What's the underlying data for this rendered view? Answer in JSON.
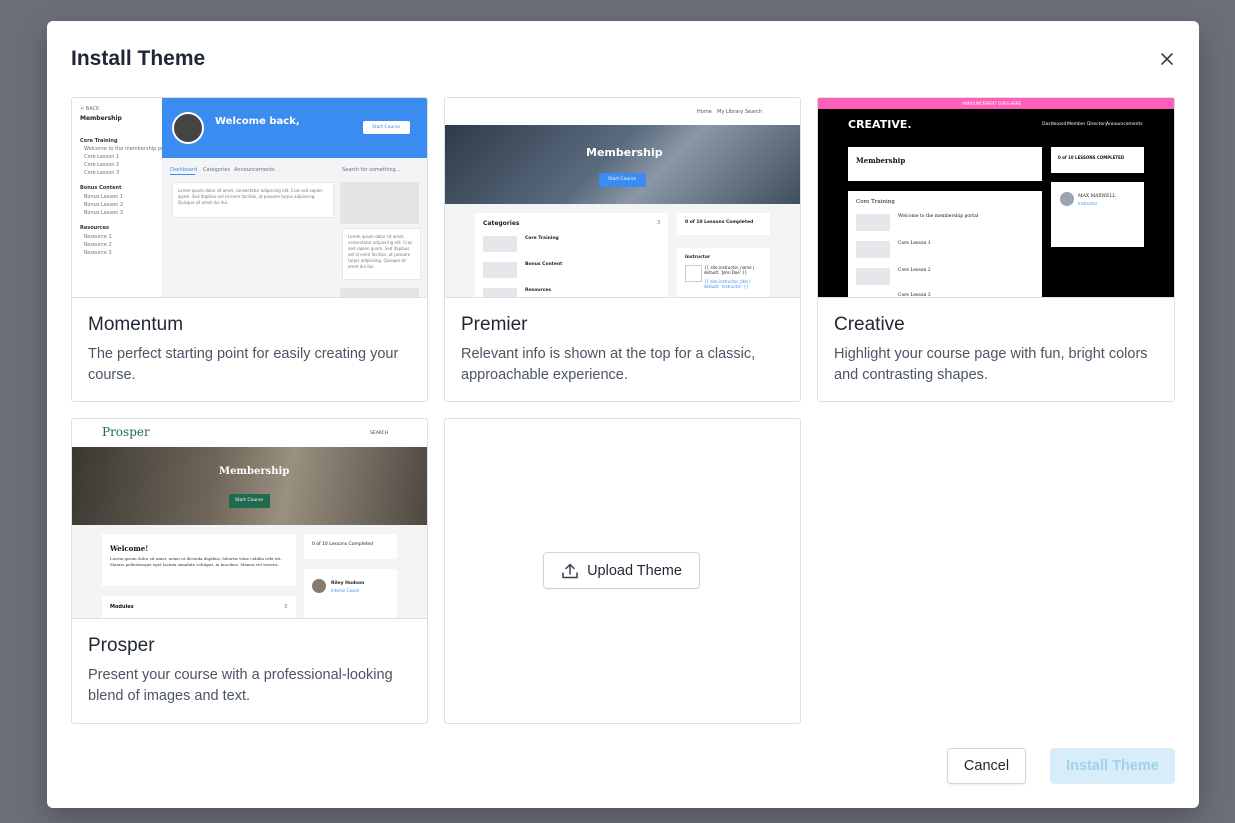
{
  "modal": {
    "title": "Install Theme",
    "close_icon": "close-icon"
  },
  "themes": [
    {
      "name": "Momentum",
      "description": "The perfect starting point for easily creating your course.",
      "preview": {
        "back": "< BACK",
        "title": "Membership",
        "welcome": "Welcome back,",
        "button": "Start Course",
        "sections": [
          "Core Training",
          "Bonus Content",
          "Resources"
        ],
        "core_items": [
          "Welcome to the membership portal",
          "Core Lesson 1",
          "Core Lesson 2",
          "Core Lesson 3"
        ],
        "bonus_items": [
          "Bonus Lesson 1",
          "Bonus Lesson 2",
          "Bonus Lesson 3"
        ],
        "resource_items": [
          "Resource 1",
          "Resource 2",
          "Resource 3"
        ],
        "tabs": [
          "Dashboard",
          "Categories",
          "Announcements"
        ],
        "search": "Search for something...",
        "lorem": "Lorem ipsum dolor sit amet, consectetur adipiscing elit. Cras sed sapien quam. Sed dapibus est id enim facilisis, at posuere turpis adipiscing. Quisque sit amet dui dui."
      }
    },
    {
      "name": "Premier",
      "description": "Relevant info is shown at the top for a classic, approachable experience.",
      "preview": {
        "nav": [
          "Home",
          "My Library",
          "Search"
        ],
        "title": "Membership",
        "button": "Start Course",
        "categories": "Categories",
        "categories_count": "3",
        "items": [
          "Core Training",
          "Bonus Content",
          "Resources"
        ],
        "progress": "0 of 10 Lessons Completed",
        "instructor": "Instructor",
        "instructor_name": "{{ site.instructor_name | default: 'John Doe' }}",
        "instructor_link": "{{ site.instructor_title | default: 'Instructor' }}"
      }
    },
    {
      "name": "Creative",
      "description": "Highlight your course page with fun, bright colors and contrasting shapes.",
      "preview": {
        "banner": "ANNOUNCEMENT GOES HERE",
        "logo": "CREATIVE.",
        "nav": [
          "Dashboard",
          "Member Directory",
          "Announcements"
        ],
        "title": "Membership",
        "progress": "0 of 10 LESSONS COMPLETED",
        "section": "Core Training",
        "lessons": [
          "Welcome to the membership portal",
          "Core Lesson 1",
          "Core Lesson 2",
          "Core Lesson 3"
        ],
        "instructor": "MAX MAXWELL",
        "instructor_role": "Instructor"
      }
    },
    {
      "name": "Prosper",
      "description": "Present your course with a professional-looking blend of images and text.",
      "preview": {
        "logo": "Prosper",
        "search": "SEARCH",
        "title": "Membership",
        "button": "Start Course",
        "welcome": "Welcome!",
        "progress": "0 of 10 Lessons Completed",
        "instructor": "Riley Hudson",
        "instructor_role": "Interior Coach",
        "modules": "Modules",
        "modules_count": "3",
        "lorem": "Lorem ipsum dolor sit amet, nemo ut dicenda dapibus, lobortis vitae cubilia orbi est. Mauris pellentesque eget lacinia simulata volutpat, in faucibus. Mauris vel viverra."
      }
    }
  ],
  "upload": {
    "label": "Upload Theme",
    "icon": "upload-icon"
  },
  "footer": {
    "cancel": "Cancel",
    "install": "Install Theme"
  },
  "colors": {
    "accent_blue": "#3b82f6",
    "creative_pink": "#ff5fb8",
    "prosper_green": "#1f6b4f",
    "install_disabled_bg": "#d7eefa"
  }
}
